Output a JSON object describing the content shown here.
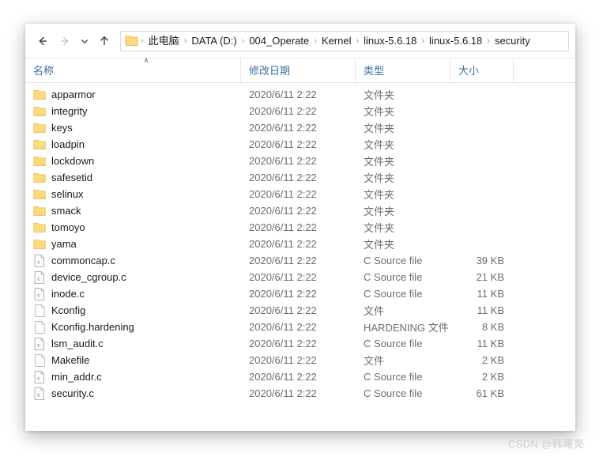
{
  "window": {
    "nav": {
      "back_icon": "arrow-left-icon",
      "back_enabled": true,
      "forward_icon": "arrow-right-icon",
      "forward_enabled": false,
      "recent_icon": "chevron-down-icon",
      "up_icon": "arrow-up-icon",
      "address_folder_icon": "folder-icon",
      "separator": "›",
      "breadcrumbs": [
        "此电脑",
        "DATA (D:)",
        "004_Operate",
        "Kernel",
        "linux-5.6.18",
        "linux-5.6.18",
        "security"
      ]
    },
    "columns": {
      "name": "名称",
      "date": "修改日期",
      "type": "类型",
      "size": "大小",
      "sort_caret": "∧"
    },
    "rows": [
      {
        "icon": "folder-icon",
        "name": "apparmor",
        "date": "2020/6/11 2:22",
        "type": "文件夹",
        "size": ""
      },
      {
        "icon": "folder-icon",
        "name": "integrity",
        "date": "2020/6/11 2:22",
        "type": "文件夹",
        "size": ""
      },
      {
        "icon": "folder-icon",
        "name": "keys",
        "date": "2020/6/11 2:22",
        "type": "文件夹",
        "size": ""
      },
      {
        "icon": "folder-icon",
        "name": "loadpin",
        "date": "2020/6/11 2:22",
        "type": "文件夹",
        "size": ""
      },
      {
        "icon": "folder-icon",
        "name": "lockdown",
        "date": "2020/6/11 2:22",
        "type": "文件夹",
        "size": ""
      },
      {
        "icon": "folder-icon",
        "name": "safesetid",
        "date": "2020/6/11 2:22",
        "type": "文件夹",
        "size": ""
      },
      {
        "icon": "folder-icon",
        "name": "selinux",
        "date": "2020/6/11 2:22",
        "type": "文件夹",
        "size": ""
      },
      {
        "icon": "folder-icon",
        "name": "smack",
        "date": "2020/6/11 2:22",
        "type": "文件夹",
        "size": ""
      },
      {
        "icon": "folder-icon",
        "name": "tomoyo",
        "date": "2020/6/11 2:22",
        "type": "文件夹",
        "size": ""
      },
      {
        "icon": "folder-icon",
        "name": "yama",
        "date": "2020/6/11 2:22",
        "type": "文件夹",
        "size": ""
      },
      {
        "icon": "c-source-icon",
        "name": "commoncap.c",
        "date": "2020/6/11 2:22",
        "type": "C Source file",
        "size": "39 KB"
      },
      {
        "icon": "c-source-icon",
        "name": "device_cgroup.c",
        "date": "2020/6/11 2:22",
        "type": "C Source file",
        "size": "21 KB"
      },
      {
        "icon": "c-source-icon",
        "name": "inode.c",
        "date": "2020/6/11 2:22",
        "type": "C Source file",
        "size": "11 KB"
      },
      {
        "icon": "blank-file-icon",
        "name": "Kconfig",
        "date": "2020/6/11 2:22",
        "type": "文件",
        "size": "11 KB"
      },
      {
        "icon": "blank-file-icon",
        "name": "Kconfig.hardening",
        "date": "2020/6/11 2:22",
        "type": "HARDENING 文件",
        "size": "8 KB"
      },
      {
        "icon": "c-source-icon",
        "name": "lsm_audit.c",
        "date": "2020/6/11 2:22",
        "type": "C Source file",
        "size": "11 KB"
      },
      {
        "icon": "blank-file-icon",
        "name": "Makefile",
        "date": "2020/6/11 2:22",
        "type": "文件",
        "size": "2 KB"
      },
      {
        "icon": "c-source-icon",
        "name": "min_addr.c",
        "date": "2020/6/11 2:22",
        "type": "C Source file",
        "size": "2 KB"
      },
      {
        "icon": "c-source-icon",
        "name": "security.c",
        "date": "2020/6/11 2:22",
        "type": "C Source file",
        "size": "61 KB"
      }
    ]
  },
  "watermark": "CSDN @韩曙亮",
  "colors": {
    "column_header_text": "#3a6ea5",
    "folder_icon": "#ffd97d",
    "c_source_letter": "#3a3af0",
    "secondary_text": "#6d6d6d",
    "primary_text": "#1a1a1a"
  }
}
